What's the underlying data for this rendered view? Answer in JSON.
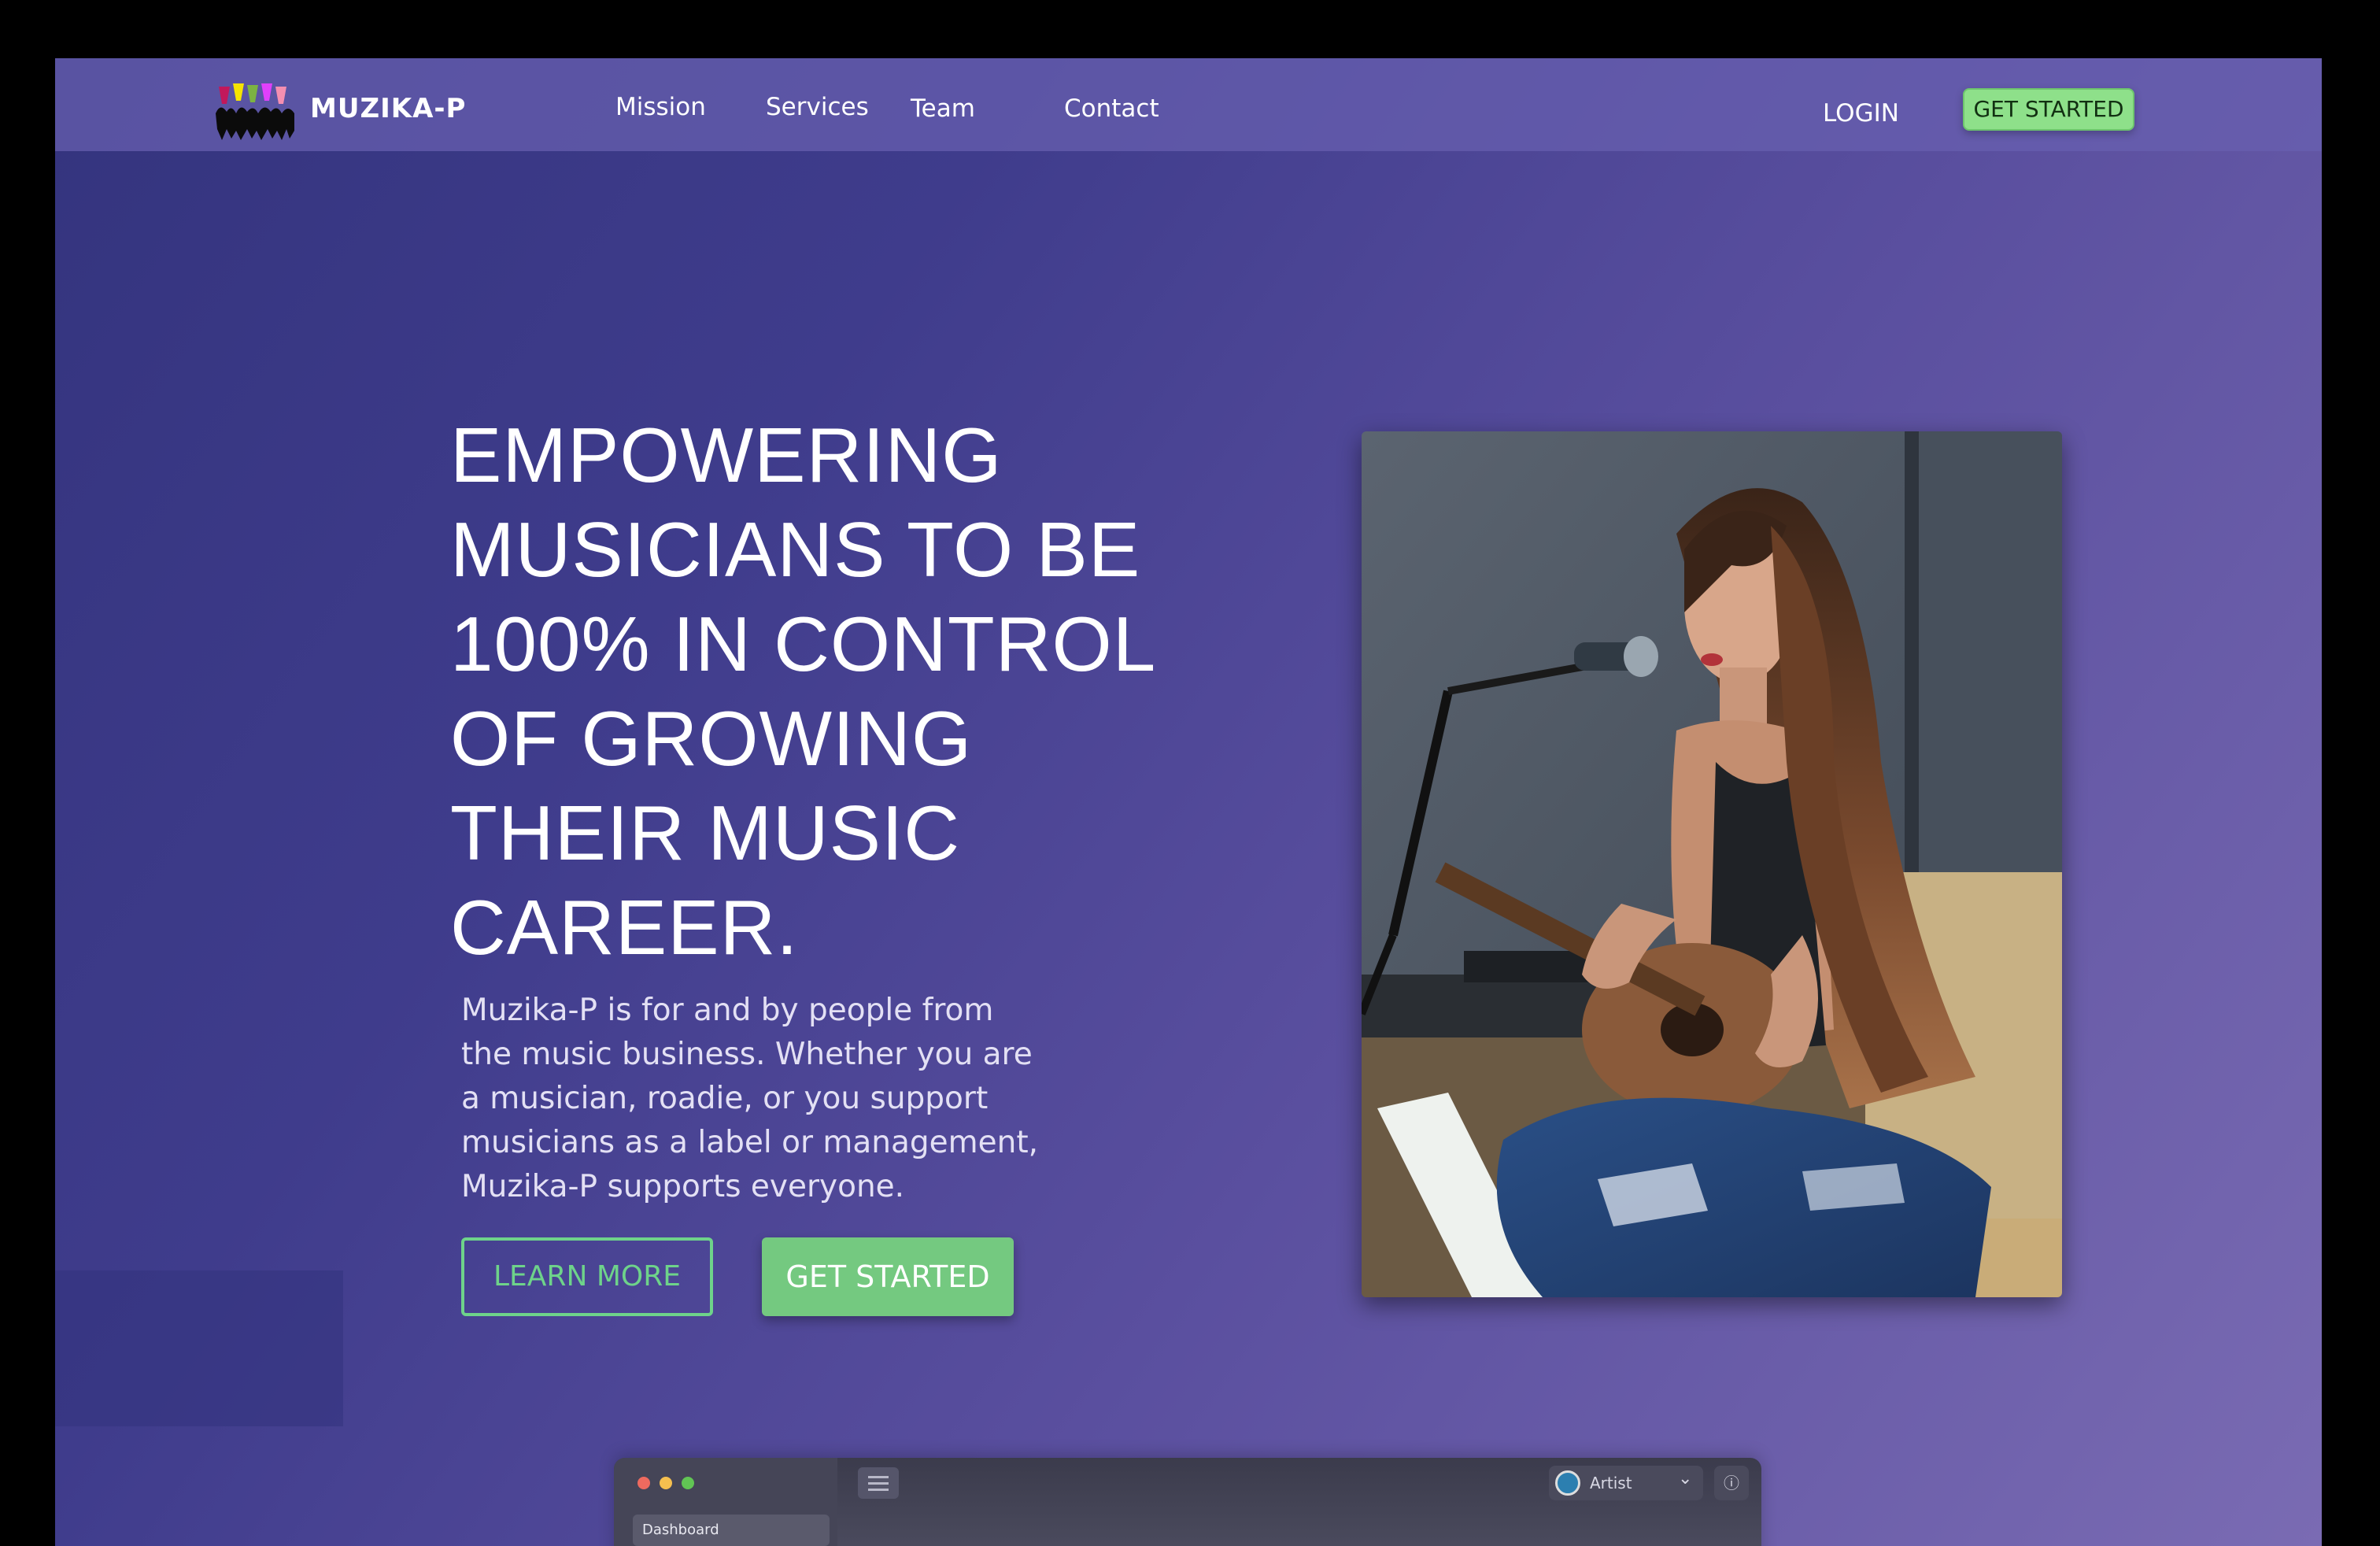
{
  "header": {
    "brand": "MUZIKA-P",
    "nav": [
      "Mission",
      "Services",
      "Team",
      "Contact"
    ],
    "login": "LOGIN",
    "cta": "GET STARTED"
  },
  "hero": {
    "headline_lines": [
      "EMPOWERING",
      "MUSICIANS TO BE",
      "100% IN CONTROL",
      "OF GROWING",
      "THEIR MUSIC",
      "CAREER."
    ],
    "description_lines": [
      "Muzika-P is for and by people from",
      "the music business. Whether you are",
      "a musician, roadie, or you support",
      "musicians as a label or management,",
      "Muzika-P supports everyone."
    ],
    "learn_more": "LEARN MORE",
    "get_started": "GET STARTED"
  },
  "app_preview": {
    "dashboard": "Dashboard",
    "role": "Artist",
    "icons": [
      "menu-icon",
      "chevron-down-icon",
      "help-icon"
    ]
  },
  "colors": {
    "accent_green": "#74c980",
    "nav_cta_green": "#8ee08a",
    "background_start": "#34347e",
    "background_end": "#7a6bb3"
  }
}
